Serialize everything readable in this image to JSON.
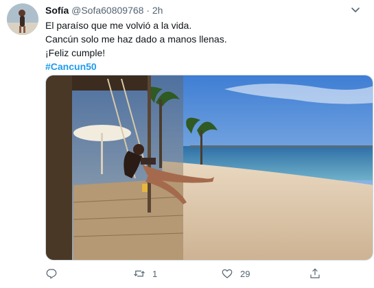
{
  "tweet": {
    "author_name": "Sofía",
    "handle": "@Sofa60809768",
    "separator": "·",
    "time": "2h",
    "lines": [
      "El paraíso que me volvió a la vida.",
      "Cancún solo me haz dado a manos llenas.",
      "¡Feliz cumple!"
    ],
    "hashtag": "#Cancun50",
    "photo_icon": "beach-photo",
    "actions": {
      "reply_count": "",
      "retweet_count": "1",
      "like_count": "29",
      "share_count": ""
    }
  },
  "colors": {
    "link": "#1d9bf0",
    "secondary_text": "#536471",
    "border": "#cfd9de"
  }
}
